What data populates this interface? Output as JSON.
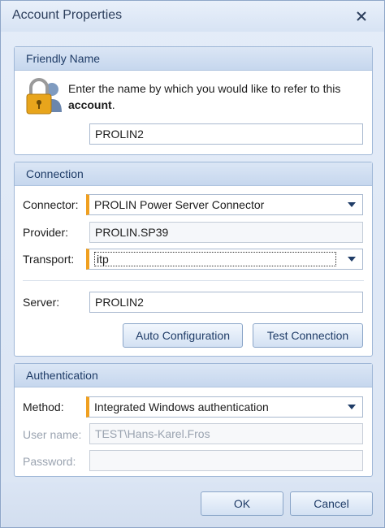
{
  "window": {
    "title": "Account Properties"
  },
  "friendly_name": {
    "header": "Friendly Name",
    "description_prefix": "Enter the name by which you would like to refer to this",
    "description_bold": "account",
    "description_suffix": ".",
    "value": "PROLIN2"
  },
  "connection": {
    "header": "Connection",
    "connector_label": "Connector:",
    "connector_value": "PROLIN Power Server Connector",
    "provider_label": "Provider:",
    "provider_value": "PROLIN.SP39",
    "transport_label": "Transport:",
    "transport_value": "itp",
    "server_label": "Server:",
    "server_value": "PROLIN2",
    "auto_config_label": "Auto Configuration",
    "test_connection_label": "Test Connection"
  },
  "authentication": {
    "header": "Authentication",
    "method_label": "Method:",
    "method_value": "Integrated Windows authentication",
    "username_label": "User name:",
    "username_value": "TEST\\Hans-Karel.Fros",
    "password_label": "Password:",
    "password_value": ""
  },
  "footer": {
    "ok_label": "OK",
    "cancel_label": "Cancel"
  },
  "colors": {
    "accent": "#f0a020",
    "header_text": "#1f3c67"
  },
  "icons": {
    "account": "lock-user-icon",
    "close": "close-icon",
    "dropdown": "chevron-down-icon"
  }
}
